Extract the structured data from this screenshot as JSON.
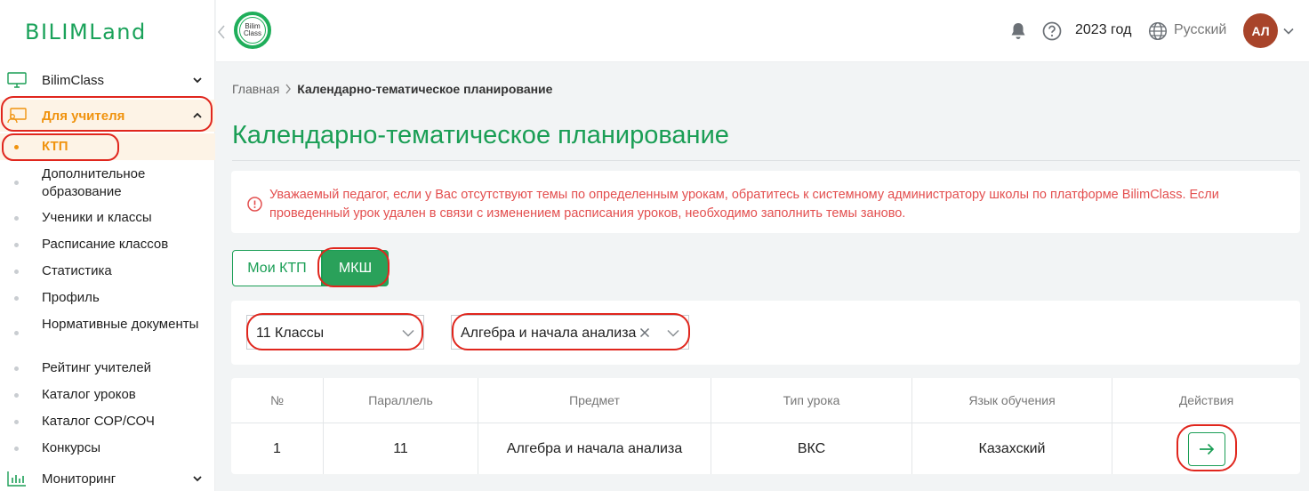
{
  "brand": {
    "logo_text": "BILIMLand",
    "bilimclass_badge": "Bilim Class"
  },
  "colors": {
    "brand_green": "#1a9e55",
    "active_orange": "#f0930f",
    "alert_red": "#e34f4f",
    "highlight_red": "#e0261d",
    "avatar_bg": "#a8442a"
  },
  "header": {
    "year": "2023 год",
    "language": "Русский",
    "avatar_initials": "АЛ",
    "icons": [
      "bell-icon",
      "help-icon",
      "globe-icon",
      "chevron-down-icon"
    ]
  },
  "sidebar": {
    "sections": [
      {
        "label": "BilimClass",
        "icon": "monitor-icon",
        "expanded": false
      },
      {
        "label": "Для учителя",
        "icon": "teacher-board-icon",
        "expanded": true
      },
      {
        "label": "Мониторинг",
        "icon": "bar-chart-icon",
        "expanded": false
      }
    ],
    "teacher_items": [
      {
        "label": "КТП",
        "active": true
      },
      {
        "label": "Дополнительное образование"
      },
      {
        "label": "Ученики и классы"
      },
      {
        "label": "Расписание классов"
      },
      {
        "label": "Статистика"
      },
      {
        "label": "Профиль"
      },
      {
        "label": "Нормативные документы"
      },
      {
        "label": "Рейтинг учителей"
      },
      {
        "label": "Каталог уроков"
      },
      {
        "label": "Каталог СОР/СОЧ"
      },
      {
        "label": "Конкурсы"
      }
    ]
  },
  "breadcrumb": {
    "home": "Главная",
    "current": "Календарно-тематическое планирование"
  },
  "page_title": "Календарно-тематическое планирование",
  "alert": {
    "text": "Уважаемый педагог, если у Вас отсутствуют темы по определенным урокам, обратитесь к системному администратору школы по платформе BilimClass. Если проведенный урок удален в связи с изменением расписания уроков, необходимо заполнить темы заново."
  },
  "toggle": {
    "option_a": "Мои КТП",
    "option_b": "МКШ",
    "selected": "МКШ"
  },
  "filters": {
    "grade": "11 Классы",
    "subject": "Алгебра и начала анализа"
  },
  "table": {
    "columns": [
      "№",
      "Параллель",
      "Предмет",
      "Тип урока",
      "Язык обучения",
      "Действия"
    ],
    "rows": [
      {
        "num": "1",
        "parallel": "11",
        "subject": "Алгебра и начала анализа",
        "lesson_type": "ВКС",
        "language": "Казахский",
        "action_icon": "arrow-right-icon"
      }
    ]
  }
}
